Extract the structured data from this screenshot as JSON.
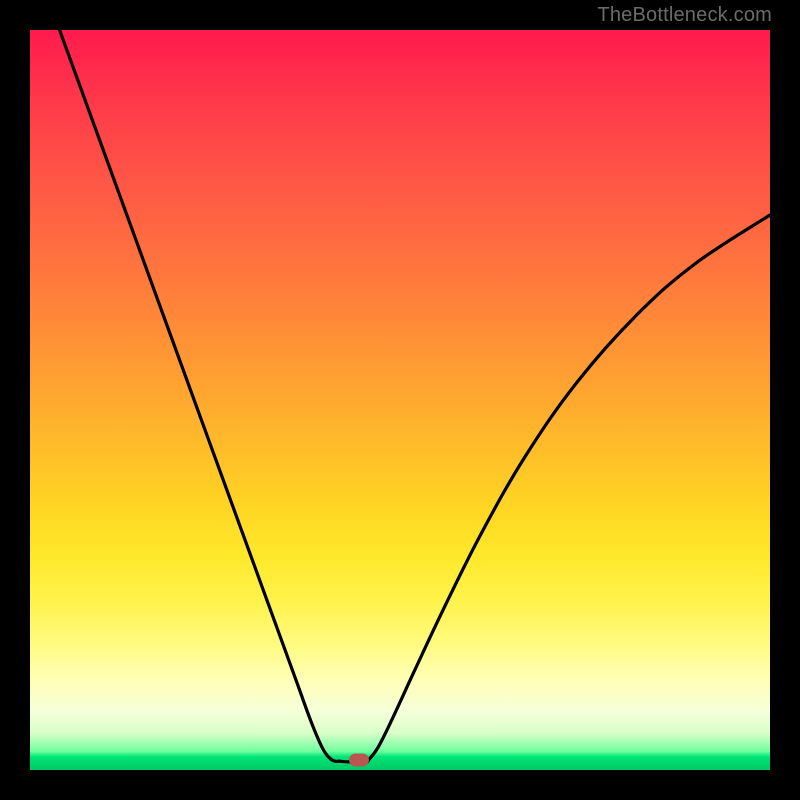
{
  "watermark": "TheBottleneck.com",
  "colors": {
    "frame": "#000000",
    "curve": "#000000",
    "marker": "#b8564f",
    "grad_top": "#ff1a4d",
    "grad_bottom": "#00c864"
  },
  "chart_data": {
    "type": "line",
    "title": "",
    "xlabel": "",
    "ylabel": "",
    "xlim": [
      0,
      100
    ],
    "ylim": [
      0,
      100
    ],
    "note": "Values are read in percent of plot width/height. y measured from bottom (0) to top (100).",
    "series": [
      {
        "name": "left-branch",
        "x": [
          4,
          8,
          12,
          16,
          20,
          24,
          28,
          32,
          36,
          38,
          39.5,
          40.5,
          41.2,
          41.8
        ],
        "y": [
          100,
          89,
          78,
          67,
          56,
          45,
          34,
          23,
          12,
          6.5,
          3.0,
          1.6,
          1.2,
          1.2
        ]
      },
      {
        "name": "flat-min",
        "x": [
          41.8,
          43.0,
          44.3,
          45.6
        ],
        "y": [
          1.2,
          1.1,
          1.1,
          1.2
        ]
      },
      {
        "name": "right-branch",
        "x": [
          45.6,
          47.0,
          49.0,
          52.0,
          56.0,
          61.0,
          67.0,
          74.0,
          82.0,
          90.0,
          100.0
        ],
        "y": [
          1.2,
          3.0,
          7.0,
          13.5,
          22.0,
          32.0,
          42.5,
          52.5,
          61.5,
          68.5,
          75.0
        ]
      }
    ],
    "marker": {
      "x": 44.5,
      "y": 1.4
    }
  }
}
